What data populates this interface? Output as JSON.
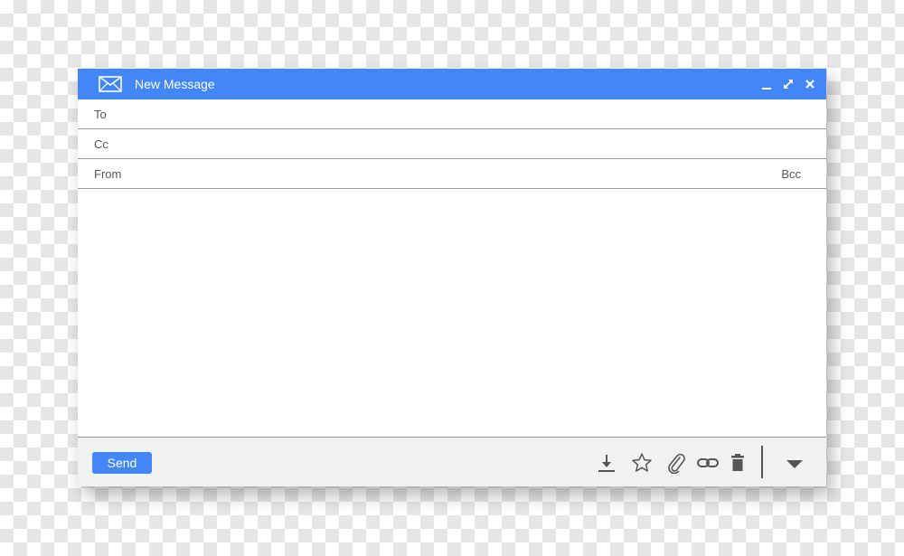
{
  "window": {
    "title": "New Message",
    "accent_color": "#4287f5",
    "controls": [
      "minimize-icon",
      "expand-icon",
      "close-icon"
    ]
  },
  "fields": {
    "to_label": "To",
    "cc_label": "Cc",
    "from_label": "From",
    "bcc_label": "Bcc"
  },
  "footer": {
    "send_label": "Send",
    "tools": [
      "download-icon",
      "star-icon",
      "paperclip-icon",
      "link-icon",
      "trash-icon",
      "dropdown-arrow-icon"
    ]
  }
}
